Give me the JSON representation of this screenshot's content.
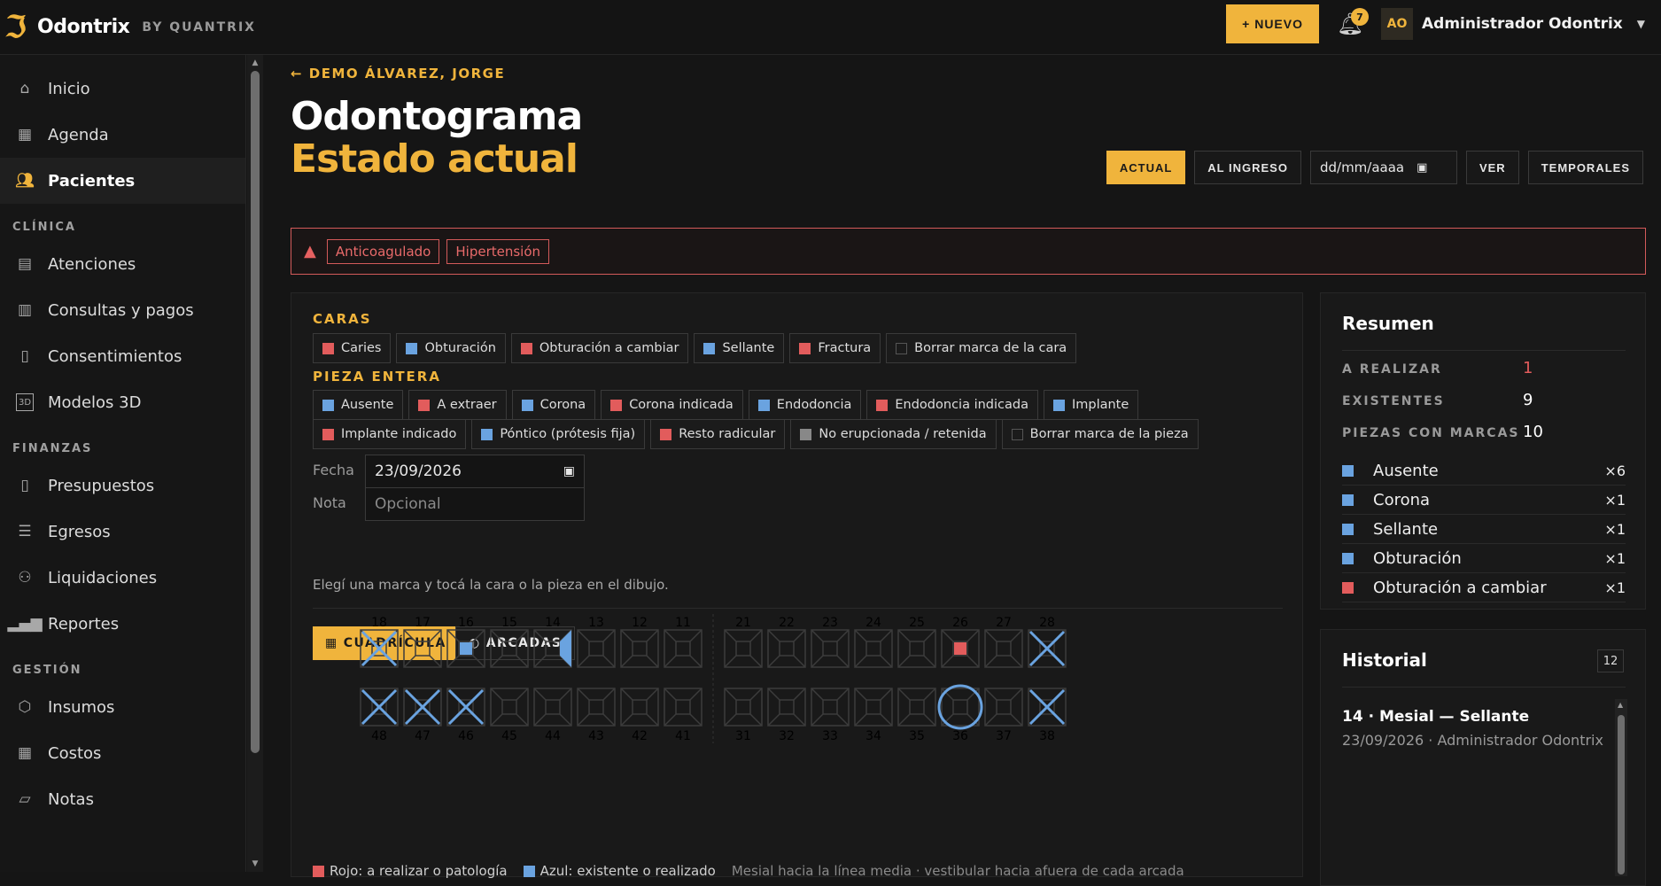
{
  "brand": {
    "name": "Odontrix",
    "by": "BY QUANTRIX"
  },
  "topbar": {
    "new_label": "+ NUEVO",
    "notifications": "7",
    "avatar": "AO",
    "user": "Administrador Odontrix"
  },
  "sidebar": {
    "main": [
      {
        "label": "Inicio",
        "icon": "home-icon"
      },
      {
        "label": "Agenda",
        "icon": "calendar-icon"
      },
      {
        "label": "Pacientes",
        "icon": "users-icon"
      }
    ],
    "sections": [
      {
        "title": "CLÍNICA",
        "items": [
          {
            "label": "Atenciones",
            "icon": "clipboard-icon"
          },
          {
            "label": "Consultas y pagos",
            "icon": "receipt-icon"
          },
          {
            "label": "Consentimientos",
            "icon": "document-icon"
          },
          {
            "label": "Modelos 3D",
            "icon": "3d-icon"
          }
        ]
      },
      {
        "title": "FINANZAS",
        "items": [
          {
            "label": "Presupuestos",
            "icon": "file-icon"
          },
          {
            "label": "Egresos",
            "icon": "list-icon"
          },
          {
            "label": "Liquidaciones",
            "icon": "payout-icon"
          },
          {
            "label": "Reportes",
            "icon": "chart-icon"
          }
        ]
      },
      {
        "title": "GESTIÓN",
        "items": [
          {
            "label": "Insumos",
            "icon": "box-icon"
          },
          {
            "label": "Costos",
            "icon": "calculator-icon"
          },
          {
            "label": "Notas",
            "icon": "note-icon"
          }
        ]
      }
    ]
  },
  "page": {
    "back": "← DEMO ÁLVAREZ, JORGE",
    "title1": "Odontograma",
    "title2": "Estado actual",
    "views": {
      "actual": "ACTUAL",
      "ingreso": "AL INGRESO",
      "date_placeholder": "dd/mm/aaaa",
      "ver": "VER",
      "temporales": "TEMPORALES"
    }
  },
  "alerts": [
    "Anticoagulado",
    "Hipertensión"
  ],
  "caras": {
    "title": "CARAS",
    "chips": [
      {
        "label": "Caries",
        "color": "red"
      },
      {
        "label": "Obturación",
        "color": "blue"
      },
      {
        "label": "Obturación a cambiar",
        "color": "red"
      },
      {
        "label": "Sellante",
        "color": "blue"
      },
      {
        "label": "Fractura",
        "color": "red"
      },
      {
        "label": "Borrar marca de la cara",
        "color": "empty"
      }
    ]
  },
  "pieza": {
    "title": "PIEZA ENTERA",
    "row1": [
      {
        "label": "Ausente",
        "color": "blue"
      },
      {
        "label": "A extraer",
        "color": "red"
      },
      {
        "label": "Corona",
        "color": "blue"
      },
      {
        "label": "Corona indicada",
        "color": "red"
      },
      {
        "label": "Endodoncia",
        "color": "blue"
      },
      {
        "label": "Endodoncia indicada",
        "color": "red"
      },
      {
        "label": "Implante",
        "color": "blue"
      }
    ],
    "row2": [
      {
        "label": "Implante indicado",
        "color": "red"
      },
      {
        "label": "Póntico (prótesis fija)",
        "color": "blue"
      },
      {
        "label": "Resto radicular",
        "color": "red"
      },
      {
        "label": "No erupcionada / retenida",
        "color": "gray"
      },
      {
        "label": "Borrar marca de la pieza",
        "color": "empty"
      }
    ]
  },
  "form": {
    "fecha_label": "Fecha",
    "fecha_value": "23/09/2026",
    "nota_label": "Nota",
    "nota_placeholder": "Opcional",
    "hint": "Elegí una marca y tocá la cara o la pieza en el dibujo."
  },
  "toggles": {
    "grid": "CUADRÍCULA",
    "arcs": "ARCADAS"
  },
  "odontogram": {
    "upper": [
      {
        "n": "18",
        "mark": "absent"
      },
      {
        "n": "17",
        "mark": ""
      },
      {
        "n": "16",
        "mark": "obturacion-center"
      },
      {
        "n": "15",
        "mark": ""
      },
      {
        "n": "14",
        "mark": "sellante-mesial"
      },
      {
        "n": "13",
        "mark": ""
      },
      {
        "n": "12",
        "mark": ""
      },
      {
        "n": "11",
        "mark": ""
      },
      {
        "n": "21",
        "mark": ""
      },
      {
        "n": "22",
        "mark": ""
      },
      {
        "n": "23",
        "mark": ""
      },
      {
        "n": "24",
        "mark": ""
      },
      {
        "n": "25",
        "mark": ""
      },
      {
        "n": "26",
        "mark": "cambiar-center"
      },
      {
        "n": "27",
        "mark": ""
      },
      {
        "n": "28",
        "mark": "absent"
      }
    ],
    "lower": [
      {
        "n": "48",
        "mark": "absent"
      },
      {
        "n": "47",
        "mark": "absent"
      },
      {
        "n": "46",
        "mark": "absent"
      },
      {
        "n": "45",
        "mark": ""
      },
      {
        "n": "44",
        "mark": ""
      },
      {
        "n": "43",
        "mark": ""
      },
      {
        "n": "42",
        "mark": ""
      },
      {
        "n": "41",
        "mark": ""
      },
      {
        "n": "31",
        "mark": ""
      },
      {
        "n": "32",
        "mark": ""
      },
      {
        "n": "33",
        "mark": ""
      },
      {
        "n": "34",
        "mark": ""
      },
      {
        "n": "35",
        "mark": ""
      },
      {
        "n": "36",
        "mark": "corona"
      },
      {
        "n": "37",
        "mark": ""
      },
      {
        "n": "38",
        "mark": "absent"
      }
    ]
  },
  "legend": {
    "red": "Rojo: a realizar o patología",
    "blue": "Azul: existente o realizado",
    "note": "Mesial hacia la línea media · vestibular hacia afuera de cada arcada"
  },
  "resumen": {
    "title": "Resumen",
    "stats": [
      {
        "label": "A REALIZAR",
        "value": "1"
      },
      {
        "label": "EXISTENTES",
        "value": "9"
      },
      {
        "label": "PIEZAS CON MARCAS",
        "value": "10"
      }
    ],
    "rows": [
      {
        "name": "Ausente",
        "count": "×6",
        "color": "blue"
      },
      {
        "name": "Corona",
        "count": "×1",
        "color": "blue"
      },
      {
        "name": "Sellante",
        "count": "×1",
        "color": "blue"
      },
      {
        "name": "Obturación",
        "count": "×1",
        "color": "blue"
      },
      {
        "name": "Obturación a cambiar",
        "count": "×1",
        "color": "red"
      }
    ]
  },
  "historial": {
    "title": "Historial",
    "count": "12",
    "entry_title": "14 · Mesial — Sellante",
    "entry_meta": "23/09/2026 · Administrador Odontrix"
  },
  "colors": {
    "accent": "#f0b43c",
    "red": "#e25c5c",
    "blue": "#6aa3e0"
  }
}
